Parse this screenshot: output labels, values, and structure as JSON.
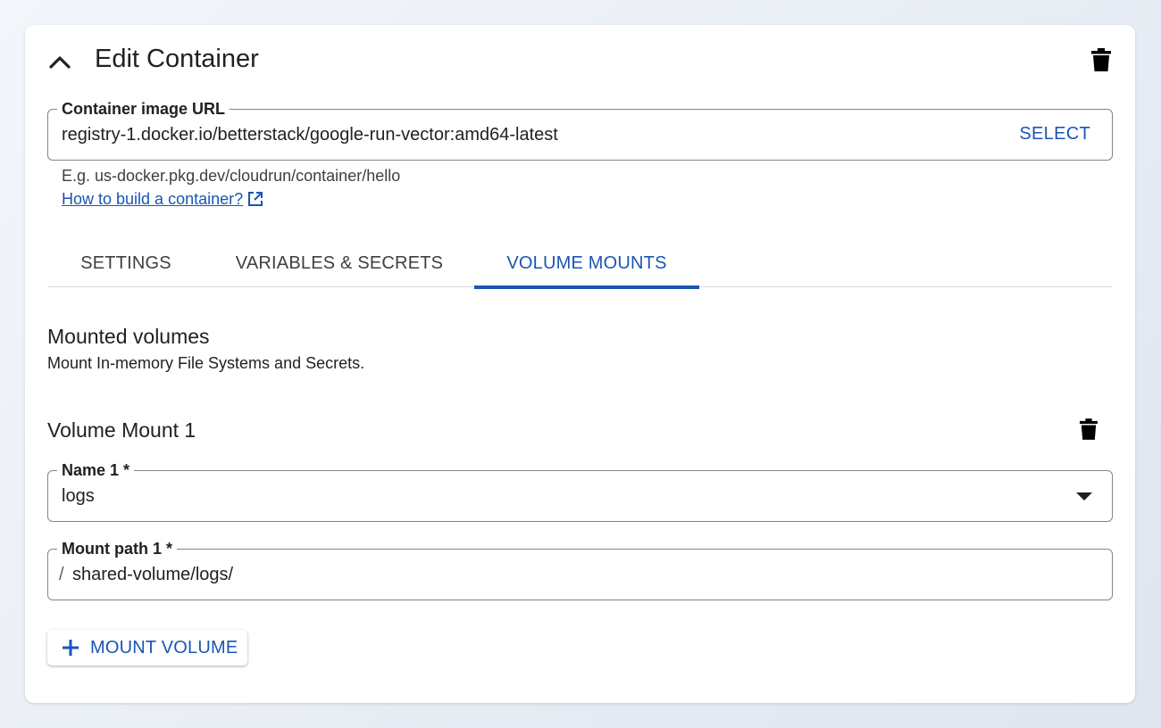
{
  "header": {
    "title": "Edit Container",
    "collapse_icon": "chevron-up-icon",
    "delete_icon": "trash-icon"
  },
  "image_url_field": {
    "label": "Container image URL",
    "value": "registry-1.docker.io/betterstack/google-run-vector:amd64-latest",
    "action_label": "SELECT",
    "hint": "E.g. us-docker.pkg.dev/cloudrun/container/hello",
    "help_link": "How to build a container?",
    "help_link_icon": "open-in-new-icon"
  },
  "tabs": [
    {
      "label": "SETTINGS",
      "active": false
    },
    {
      "label": "VARIABLES & SECRETS",
      "active": false
    },
    {
      "label": "VOLUME MOUNTS",
      "active": true
    }
  ],
  "mounted_volumes": {
    "title": "Mounted volumes",
    "description": "Mount In-memory File Systems and Secrets."
  },
  "volume_mount": {
    "title": "Volume Mount 1",
    "delete_icon": "trash-icon",
    "name_field": {
      "label": "Name 1 *",
      "value": "logs",
      "icon": "dropdown-arrow-icon"
    },
    "path_field": {
      "label": "Mount path 1 *",
      "prefix": "/",
      "value": "shared-volume/logs/"
    }
  },
  "mount_button": {
    "label": "MOUNT VOLUME",
    "icon": "plus-icon"
  },
  "colors": {
    "accent": "#1a56b3",
    "text": "#202124",
    "border": "#80868b"
  }
}
